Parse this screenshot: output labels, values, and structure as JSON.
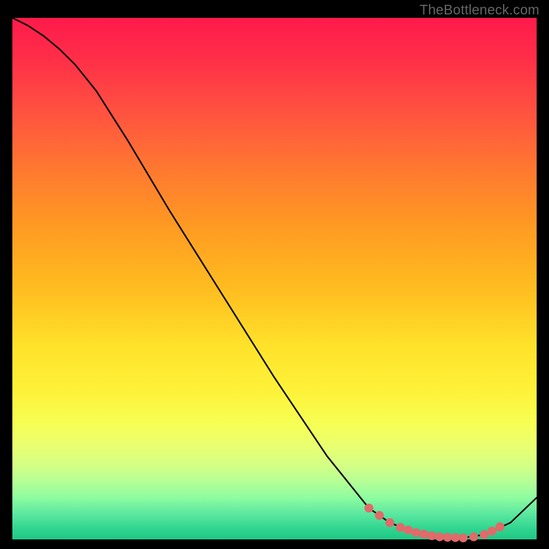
{
  "attribution": "TheBottleneck.com",
  "colors": {
    "curve": "#000000",
    "dot": "#e16a6a",
    "frame": "#000000"
  },
  "chart_data": {
    "type": "line",
    "title": "",
    "xlabel": "",
    "ylabel": "",
    "xlim": [
      0,
      100
    ],
    "ylim": [
      0,
      100
    ],
    "grid": false,
    "series": [
      {
        "name": "curve",
        "x": [
          0,
          3,
          6,
          9,
          12,
          16,
          22,
          30,
          40,
          50,
          60,
          68,
          72,
          76,
          79,
          82,
          86,
          90,
          95,
          100
        ],
        "values": [
          100,
          98.5,
          96.5,
          94,
          91,
          86,
          76.5,
          63,
          47,
          31,
          16,
          6,
          3.2,
          1.6,
          0.8,
          0.4,
          0.3,
          0.9,
          3.2,
          8
        ]
      }
    ],
    "highlight_points": {
      "name": "markers",
      "x": [
        68,
        70,
        72,
        74,
        75.5,
        77,
        78.5,
        80,
        81.5,
        83,
        84.5,
        86,
        88,
        90,
        91.5,
        93
      ],
      "values": [
        6.0,
        4.6,
        3.2,
        2.3,
        1.8,
        1.3,
        1.0,
        0.7,
        0.5,
        0.4,
        0.35,
        0.3,
        0.5,
        0.9,
        1.6,
        2.4
      ]
    }
  }
}
